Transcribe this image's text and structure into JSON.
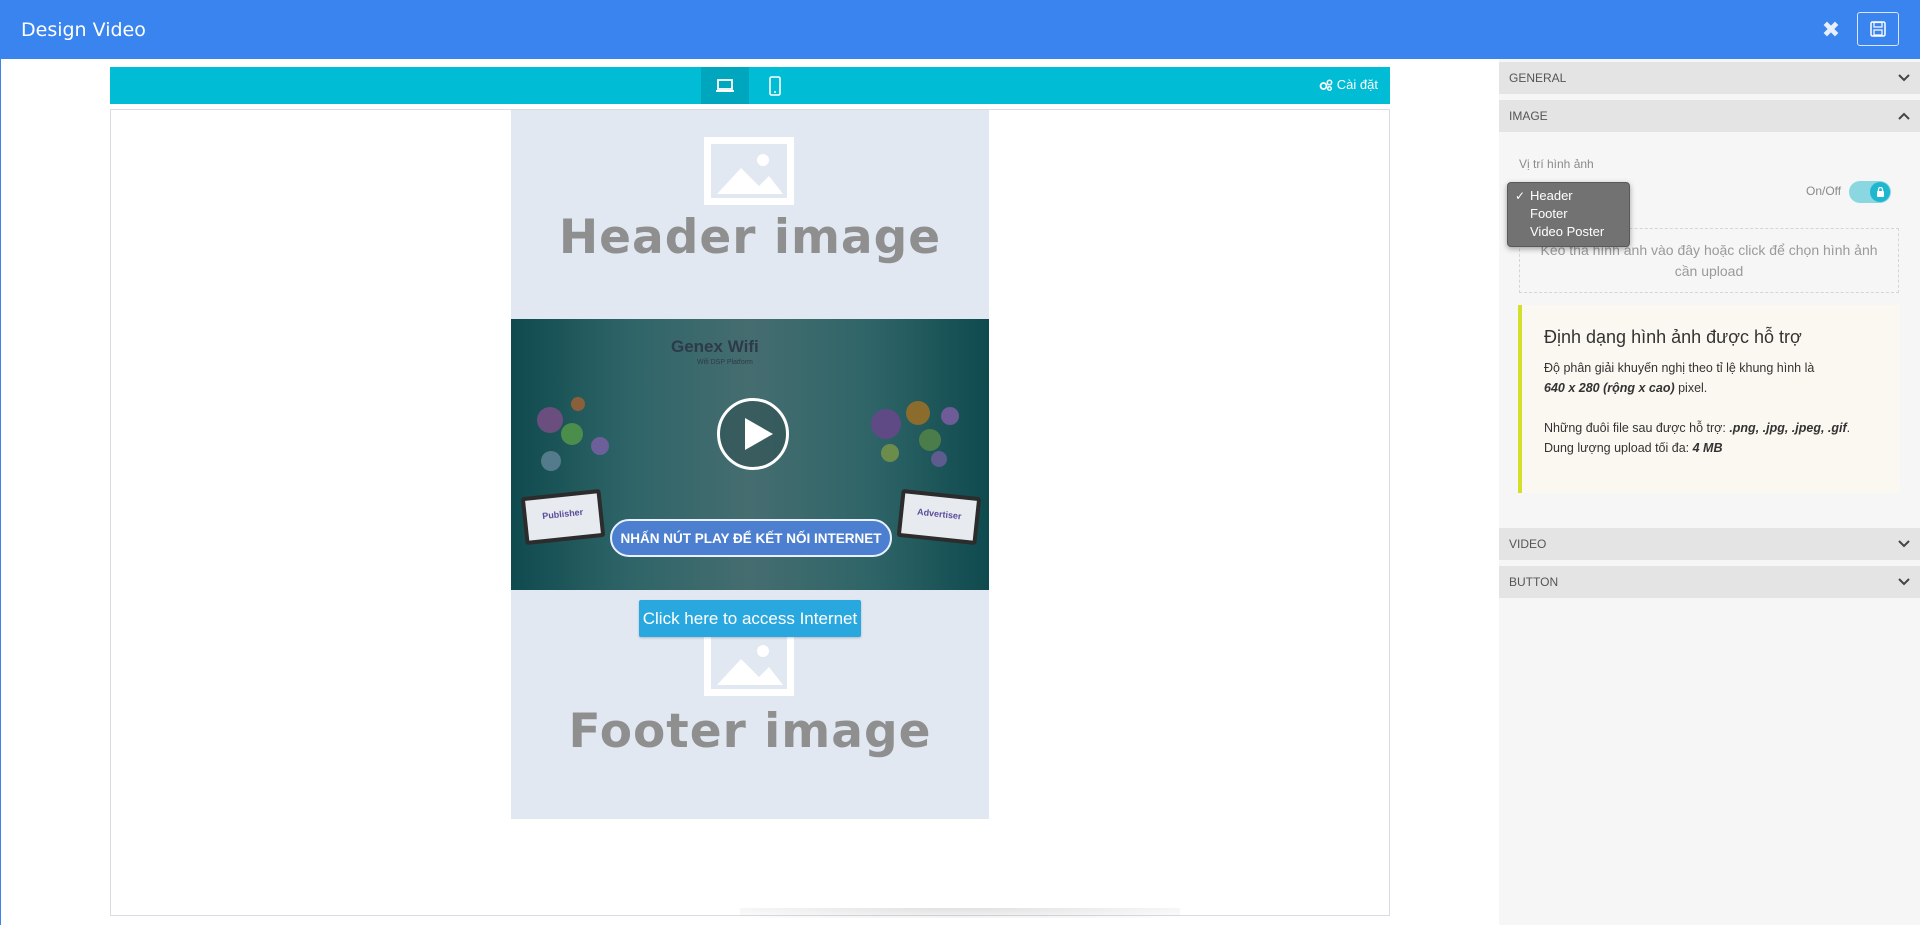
{
  "app": {
    "title": "Design Video"
  },
  "toolbar": {
    "settings_label": "Cài đặt"
  },
  "preview": {
    "header_placeholder": "Header image",
    "footer_placeholder": "Footer image",
    "video": {
      "brand": "Genex Wifi",
      "brand_sub": "Wifi DSP Platform",
      "cta": "NHẤN NÚT PLAY ĐỂ KẾT NỐI INTERNET",
      "monitor_left": "Publisher",
      "monitor_right": "Advertiser"
    },
    "access_button": "Click here to access Internet"
  },
  "panel": {
    "sections": {
      "general": "GENERAL",
      "image": "IMAGE",
      "video": "VIDEO",
      "button": "BUTTON"
    },
    "image": {
      "position_label": "Vị trí hình ảnh",
      "options": [
        "Header",
        "Footer",
        "Video Poster"
      ],
      "selected": "Header",
      "toggle_label": "On/Off",
      "toggle_on": true,
      "dropzone": "Kéo thả hình ảnh vào đây hoặc click để chọn hình ảnh cần upload",
      "info": {
        "title": "Định dạng hình ảnh được hỗ trợ",
        "line1": "Độ phân giải khuyến nghị theo tỉ lệ khung hình là",
        "resolution": "640 x 280 (rộng x cao)",
        "unit": " pixel.",
        "formats_label": "Những đuôi file sau được hỗ trợ: ",
        "formats": ".png, .jpg, .jpeg, .gif",
        "formats_end": ".",
        "max_label": "Dung lượng upload tối đa: ",
        "max_value": "4 MB"
      }
    }
  },
  "colors": {
    "topbar": "#3a84ef",
    "toolbar": "#00bcd4",
    "access_button": "#29a8e0",
    "info_border": "#d4df2a"
  }
}
